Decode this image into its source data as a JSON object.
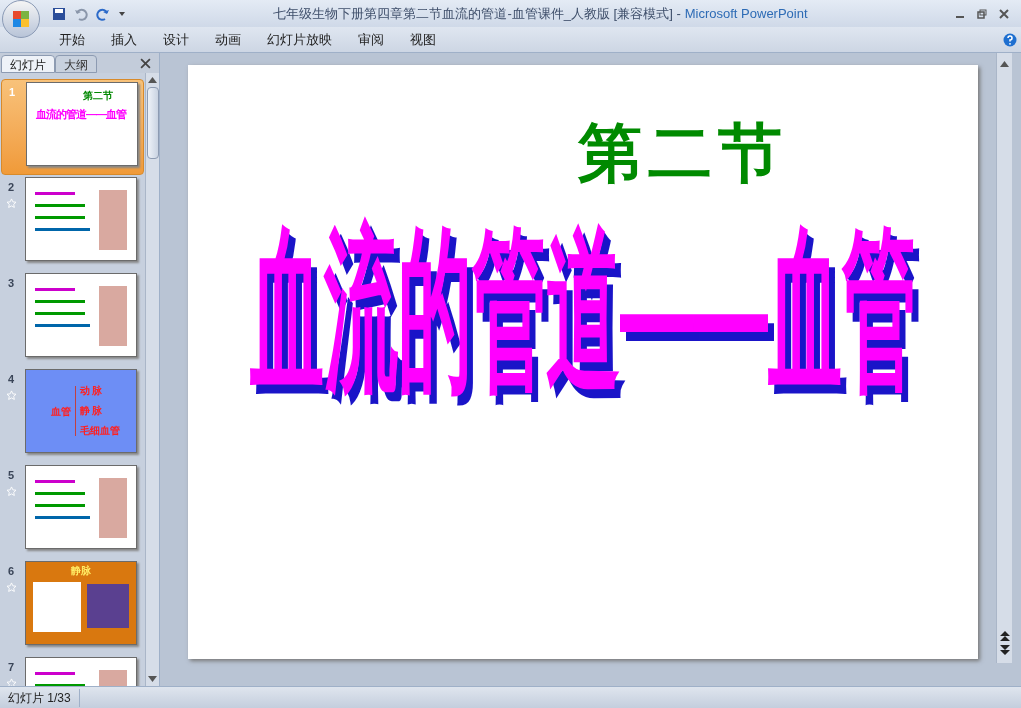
{
  "window": {
    "title": "七年级生物下册第四章第二节血流的管道-血管课件_人教版 [兼容模式] -",
    "app": "Microsoft PowerPoint"
  },
  "ribbon_tabs": [
    {
      "label": "开始",
      "selected": false
    },
    {
      "label": "插入",
      "selected": false
    },
    {
      "label": "设计",
      "selected": false
    },
    {
      "label": "动画",
      "selected": false
    },
    {
      "label": "幻灯片放映",
      "selected": false
    },
    {
      "label": "审阅",
      "selected": false
    },
    {
      "label": "视图",
      "selected": false
    }
  ],
  "panel_tabs": [
    {
      "label": "幻灯片",
      "selected": true
    },
    {
      "label": "大纲",
      "selected": false
    }
  ],
  "slides": [
    {
      "number": "1",
      "selected": true,
      "animated": false,
      "kind": "title",
      "texts": [
        "第二节",
        "血流的管道——血管"
      ]
    },
    {
      "number": "2",
      "selected": false,
      "animated": true,
      "kind": "white"
    },
    {
      "number": "3",
      "selected": false,
      "animated": false,
      "kind": "white"
    },
    {
      "number": "4",
      "selected": false,
      "animated": true,
      "kind": "blue",
      "texts": [
        "血管",
        "动 脉",
        "静 脉",
        "毛细血管"
      ]
    },
    {
      "number": "5",
      "selected": false,
      "animated": true,
      "kind": "white"
    },
    {
      "number": "6",
      "selected": false,
      "animated": true,
      "kind": "orange",
      "texts": [
        "静脉"
      ]
    },
    {
      "number": "7",
      "selected": false,
      "animated": true,
      "kind": "white"
    }
  ],
  "slide": {
    "subtitle": "第二节",
    "title": "血流的管道——血管"
  },
  "status_bar": {
    "slide_counter": "幻灯片 1/33"
  }
}
